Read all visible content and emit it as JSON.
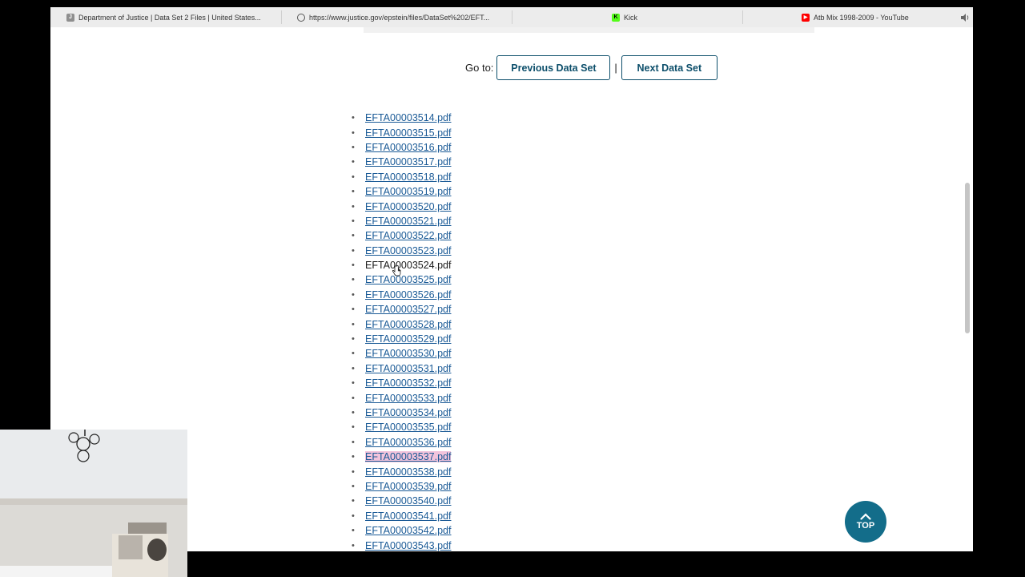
{
  "browser": {
    "tabs": [
      {
        "title": "Department of Justice | Data Set 2 Files | United States...",
        "icon": "doj-favicon-icon",
        "icon_letter": "J",
        "icon_color": "#8e8e8e"
      },
      {
        "title": "https://www.justice.gov/epstein/files/DataSet%202/EFT...",
        "icon": "loading-spinner-icon",
        "icon_letter": "",
        "icon_color": "#555555"
      },
      {
        "title": "Kick",
        "icon": "kick-favicon-icon",
        "icon_letter": "K",
        "icon_color": "#53fc18"
      },
      {
        "title": "Atb Mix 1998-2009 - YouTube",
        "icon": "youtube-favicon-icon",
        "icon_letter": "▶",
        "icon_color": "#ff0000"
      }
    ],
    "audio_icon": "speaker-icon"
  },
  "navigation": {
    "goto_label": "Go to:",
    "prev_label": "Previous Data Set",
    "separator": "|",
    "next_label": "Next Data Set"
  },
  "files": [
    "EFTA00003514.pdf",
    "EFTA00003515.pdf",
    "EFTA00003516.pdf",
    "EFTA00003517.pdf",
    "EFTA00003518.pdf",
    "EFTA00003519.pdf",
    "EFTA00003520.pdf",
    "EFTA00003521.pdf",
    "EFTA00003522.pdf",
    "EFTA00003523.pdf",
    "EFTA00003524.pdf",
    "EFTA00003525.pdf",
    "EFTA00003526.pdf",
    "EFTA00003527.pdf",
    "EFTA00003528.pdf",
    "EFTA00003529.pdf",
    "EFTA00003530.pdf",
    "EFTA00003531.pdf",
    "EFTA00003532.pdf",
    "EFTA00003533.pdf",
    "EFTA00003534.pdf",
    "EFTA00003535.pdf",
    "EFTA00003536.pdf",
    "EFTA00003537.pdf",
    "EFTA00003538.pdf",
    "EFTA00003539.pdf",
    "EFTA00003540.pdf",
    "EFTA00003541.pdf",
    "EFTA00003542.pdf",
    "EFTA00003543.pdf"
  ],
  "hovered_file": "EFTA00003524.pdf",
  "highlighted_file": "EFTA00003537.pdf",
  "back_to_top": {
    "label": "TOP",
    "icon": "chevron-up-icon"
  },
  "colors": {
    "link": "#1a5a96",
    "button_border": "#0d4f6b",
    "top_button": "#136d8a",
    "highlight": "#f2c4dc"
  }
}
